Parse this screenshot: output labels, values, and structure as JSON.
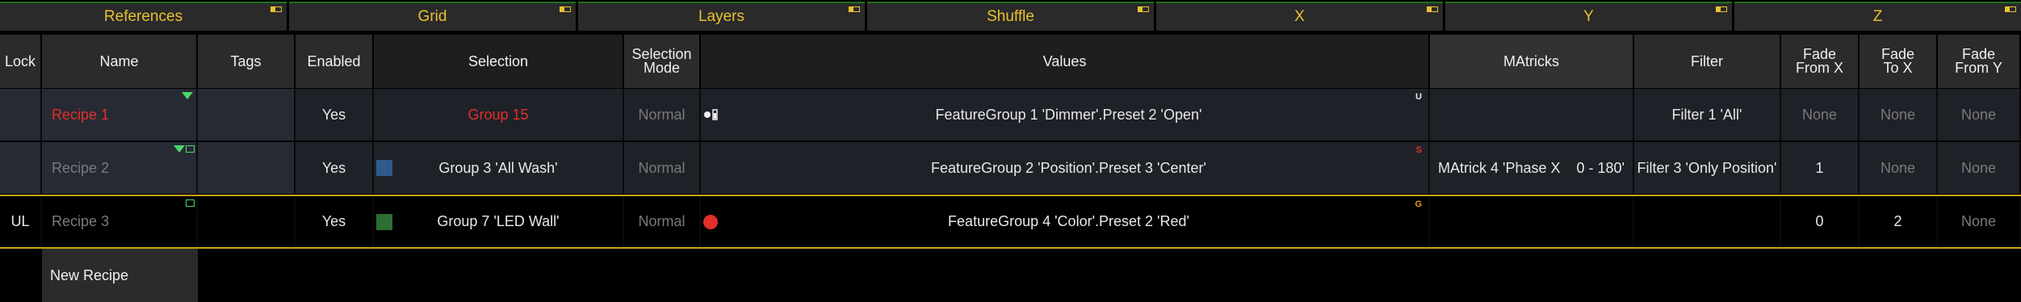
{
  "tabs": [
    "References",
    "Grid",
    "Layers",
    "Shuffle",
    "X",
    "Y",
    "Z"
  ],
  "headers": {
    "lock": "Lock",
    "name": "Name",
    "tags": "Tags",
    "enabled": "Enabled",
    "selection": "Selection",
    "selection_mode_1": "Selection",
    "selection_mode_2": "Mode",
    "values": "Values",
    "matricks": "MAtricks",
    "filter": "Filter",
    "fade_from_x_1": "Fade",
    "fade_from_x_2": "From X",
    "fade_to_x_1": "Fade",
    "fade_to_x_2": "To X",
    "fade_from_y_1": "Fade",
    "fade_from_y_2": "From Y"
  },
  "rows": [
    {
      "lock": "",
      "name": "Recipe 1",
      "tags": "",
      "enabled": "Yes",
      "selection": "Group 15",
      "selection_mode": "Normal",
      "values": "FeatureGroup 1 'Dimmer'.Preset 2 'Open'",
      "values_flag": "U",
      "matricks": "",
      "filter": "Filter 1 'All'",
      "fade_from_x": "None",
      "fade_to_x": "None",
      "fade_from_y": "None"
    },
    {
      "lock": "",
      "name": "Recipe 2",
      "tags": "",
      "enabled": "Yes",
      "selection": "Group 3 'All Wash'",
      "selection_color": "#2f5a8c",
      "selection_mode": "Normal",
      "values": "FeatureGroup 2 'Position'.Preset 3 'Center'",
      "values_flag": "S",
      "matricks": "MAtrick 4 'Phase X    0 - 180'",
      "filter": "Filter 3 'Only Position'",
      "fade_from_x": "1",
      "fade_to_x": "None",
      "fade_from_y": "None"
    },
    {
      "lock": "UL",
      "name": "Recipe 3",
      "tags": "",
      "enabled": "Yes",
      "selection": "Group 7 'LED Wall'",
      "selection_color": "#2c6e33",
      "selection_mode": "Normal",
      "values": "FeatureGroup 4 'Color'.Preset 2 'Red'",
      "values_flag": "G",
      "matricks": "",
      "filter": "",
      "fade_from_x": "0",
      "fade_to_x": "2",
      "fade_from_y": "None"
    }
  ],
  "new_recipe_label": "New Recipe",
  "colors": {
    "accent": "#e8c230",
    "red": "#e0302b",
    "green_indicator": "#4ad66a",
    "separator": "#c8a41a"
  }
}
